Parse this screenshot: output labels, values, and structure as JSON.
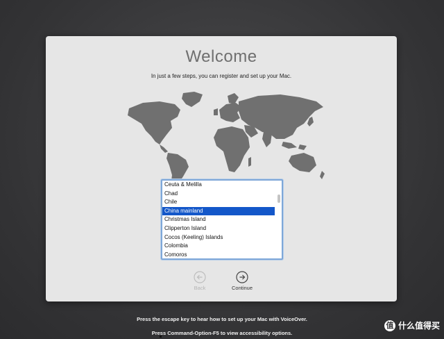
{
  "window": {
    "title": "Welcome",
    "subtitle": "In just a few steps, you can register and set up your Mac."
  },
  "countries": {
    "items": [
      "Ceuta & Melilla",
      "Chad",
      "Chile",
      "China mainland",
      "Christmas Island",
      "Clipperton Island",
      "Cocos (Keeling) Islands",
      "Colombia",
      "Comoros"
    ],
    "selected": "China mainland"
  },
  "nav": {
    "back_label": "Back",
    "continue_label": "Continue"
  },
  "hints": {
    "voiceover": "Press the escape key to hear how to set up your Mac with VoiceOver.",
    "accessibility": "Press Command-Option-F5 to view accessibility options."
  },
  "watermark": {
    "badge": "值",
    "text": "什么值得买"
  },
  "colors": {
    "selection": "#1357c9",
    "map_land": "#707070",
    "panel": "#e6e6e6",
    "desktop": "#3a3a3c"
  }
}
